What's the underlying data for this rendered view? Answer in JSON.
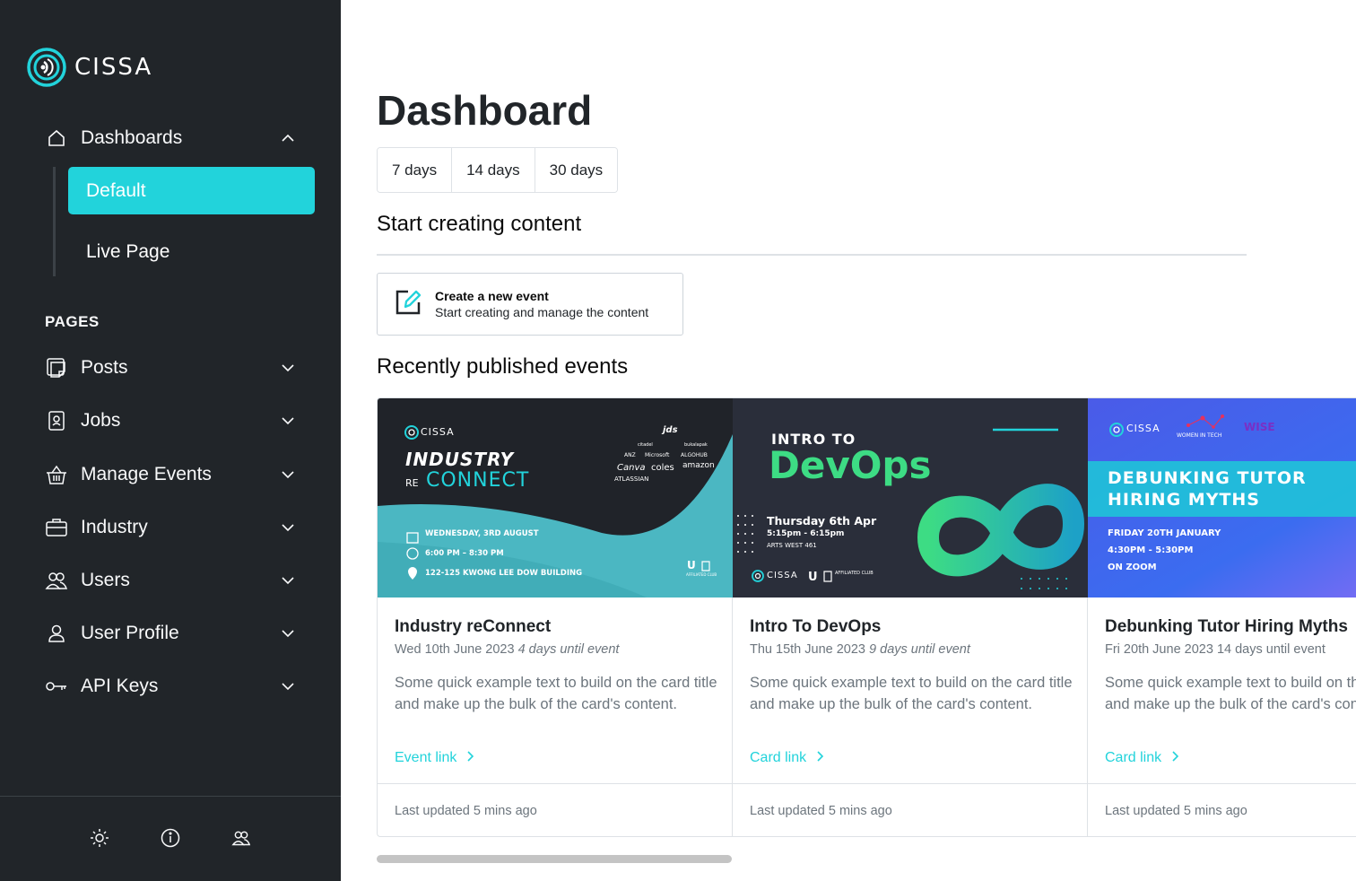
{
  "brand": {
    "name": "CISSA",
    "accent": "#22d3db",
    "sidebar_bg": "#212529"
  },
  "sidebar": {
    "dashboards_label": "Dashboards",
    "sub_items": [
      {
        "label": "Default",
        "active": true
      },
      {
        "label": "Live Page",
        "active": false
      }
    ],
    "pages_heading": "PAGES",
    "items": [
      {
        "label": "Posts",
        "icon": "posts-icon"
      },
      {
        "label": "Jobs",
        "icon": "badge-icon"
      },
      {
        "label": "Manage Events",
        "icon": "basket-icon"
      },
      {
        "label": "Industry",
        "icon": "briefcase-icon"
      },
      {
        "label": "Users",
        "icon": "users-icon"
      },
      {
        "label": "User Profile",
        "icon": "user-icon"
      },
      {
        "label": "API Keys",
        "icon": "key-icon"
      }
    ],
    "footer_icons": [
      "sun-icon",
      "info-icon",
      "users-icon"
    ]
  },
  "main": {
    "title": "Dashboard",
    "ranges": [
      "7 days",
      "14 days",
      "30 days"
    ],
    "create_section_title": "Start creating content",
    "create_card": {
      "title": "Create a new event",
      "subtitle": "Start creating and manage the content"
    },
    "events_section_title": "Recently published events",
    "events": [
      {
        "title": "Industry reConnect",
        "date": "Wed 10th June 2023",
        "until": "4 days until event",
        "until_italic": true,
        "text": "Some quick example text to build on the card title and make up the bulk of the card's content.",
        "link": "Event link",
        "footer": "Last updated 5 mins ago",
        "banner": {
          "brand": "CISSA",
          "line1": "INDUSTRY",
          "line2_prefix": "RE",
          "line2": "CONNECT",
          "sponsors": [
            "jds",
            "ANZ",
            "Microsoft",
            "ALGOHUB",
            "Canva",
            "coles",
            "amazon",
            "ATLASSIAN",
            "bukalapak",
            "citadel"
          ],
          "date": "WEDNESDAY, 3RD AUGUST",
          "time": "6:00 PM – 8:30 PM",
          "place": "122-125 KWONG LEE DOW BUILDING",
          "affiliated": "AFFILIATED CLUB"
        }
      },
      {
        "title": "Intro To DevOps",
        "date": "Thu 15th June 2023",
        "until": "9 days until event",
        "until_italic": true,
        "text": "Some quick example text to build on the card title and make up the bulk of the card's content.",
        "link": "Card link",
        "footer": "Last updated 5 mins ago",
        "banner": {
          "line1": "INTRO TO",
          "line2": "DevOps",
          "date": "Thursday 6th Apr",
          "time": "5:15pm - 6:15pm",
          "place": "ARTS WEST 461",
          "brand": "CISSA",
          "affiliated": "AFFILIATED CLUB"
        }
      },
      {
        "title": "Debunking Tutor Hiring Myths",
        "date": "Fri 20th June 2023",
        "until": "14 days until event",
        "until_italic": false,
        "text": "Some quick example text to build on the card title and make up the bulk of the card's content.",
        "link": "Card link",
        "footer": "Last updated 5 mins ago",
        "banner": {
          "brand": "CISSA",
          "partner1": "WOMEN IN TECH",
          "partner2": "WISE",
          "line1": "DEBUNKING TUTOR",
          "line2": "HIRING MYTHS",
          "date": "FRIDAY 20TH JANUARY",
          "time": "4:30PM - 5:30PM",
          "place": "ON ZOOM"
        }
      }
    ]
  }
}
